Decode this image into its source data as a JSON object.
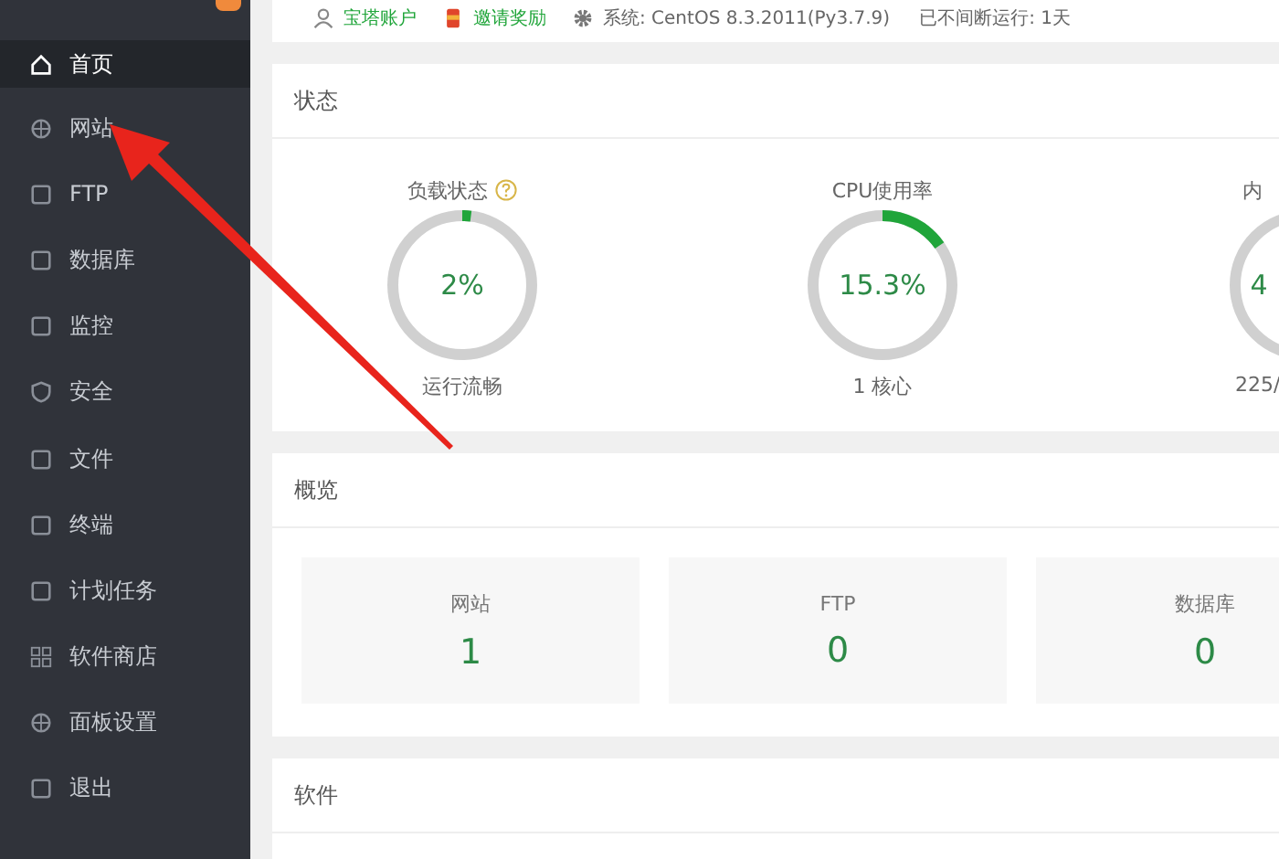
{
  "sidebar": {
    "items": [
      {
        "label": "首页",
        "selected": true
      },
      {
        "label": "网站",
        "selected": false
      },
      {
        "label": "FTP",
        "selected": false
      },
      {
        "label": "数据库",
        "selected": false
      },
      {
        "label": "监控",
        "selected": false
      },
      {
        "label": "安全",
        "selected": false
      },
      {
        "label": "文件",
        "selected": false
      },
      {
        "label": "终端",
        "selected": false
      },
      {
        "label": "计划任务",
        "selected": false
      },
      {
        "label": "软件商店",
        "selected": false
      },
      {
        "label": "面板设置",
        "selected": false
      },
      {
        "label": "退出",
        "selected": false
      }
    ]
  },
  "top_bar": {
    "account": "宝塔账户",
    "invite": "邀请奖励",
    "system": "系统:  CentOS 8.3.2011(Py3.7.9)",
    "uptime": "已不间断运行: 1天"
  },
  "status": {
    "title": "状态",
    "gauges": [
      {
        "title": "负载状态",
        "help": true,
        "value": "2%",
        "level": 0.02,
        "caption": "运行流畅"
      },
      {
        "title": "CPU使用率",
        "help": false,
        "value": "15.3%",
        "level": 0.153,
        "caption": "1 核心"
      },
      {
        "title": "内",
        "help": false,
        "value": "4",
        "caption": "225/"
      }
    ]
  },
  "overview": {
    "title": "概览",
    "cards": [
      {
        "label": "网站",
        "value": "1"
      },
      {
        "label": "FTP",
        "value": "0"
      },
      {
        "label": "数据库",
        "value": "0"
      }
    ]
  },
  "software": {
    "title": "软件"
  }
}
